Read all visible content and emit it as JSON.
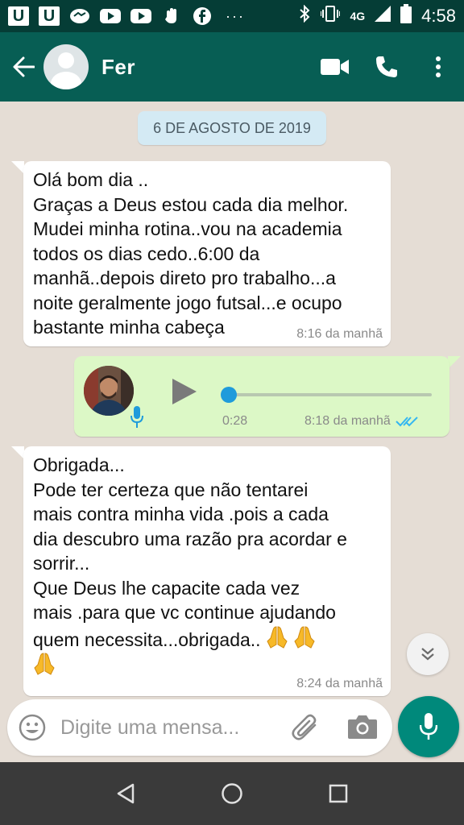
{
  "status_bar": {
    "network": "4G",
    "time": "4:58",
    "notification_boxes": [
      "U",
      "U"
    ],
    "overflow": "···"
  },
  "header": {
    "contact_name": "Fer",
    "icons": [
      "back-arrow-icon",
      "video-call-icon",
      "phone-icon",
      "more-vert-icon"
    ],
    "color": "#075e54"
  },
  "chat": {
    "date_chip": "6 DE AGOSTO DE 2019",
    "messages": [
      {
        "direction": "in",
        "lines": [
          "Olá bom dia ..",
          "Graças a Deus estou cada dia melhor.",
          "Mudei minha rotina..vou na academia",
          "todos os dias cedo..6:00 da",
          "manhã..depois direto pro trabalho...a",
          "noite geralmente jogo futsal...e ocupo",
          "bastante minha cabeça"
        ],
        "time": "8:16 da manhã"
      },
      {
        "direction": "out",
        "type": "voice",
        "duration": "0:28",
        "progress": 0,
        "time": "8:18 da manhã",
        "status": "read"
      },
      {
        "direction": "in",
        "lines": [
          "Obrigada...",
          "Pode ter certeza que não tentarei",
          "mais contra minha vida .pois a cada",
          "dia descubro uma razão pra acordar e",
          "sorrir...",
          "Que Deus lhe capacite cada vez",
          "mais .para que vc continue ajudando",
          "quem necessita...obrigada.."
        ],
        "emoji": "folded-hands",
        "time": "8:24 da manhã"
      }
    ],
    "colors": {
      "background": "#e5ddd5",
      "outgoing": "#dcf8c6",
      "incoming": "#ffffff",
      "read_ticks": "#34b7f1"
    }
  },
  "composer": {
    "placeholder": "Digite uma mensa...",
    "value": "",
    "icons": [
      "emoji-icon",
      "attach-icon",
      "camera-icon",
      "mic-icon"
    ],
    "mic_color": "#00897b"
  },
  "nav_bar": {
    "icons": [
      "back-triangle-icon",
      "home-circle-icon",
      "recents-square-icon"
    ]
  }
}
